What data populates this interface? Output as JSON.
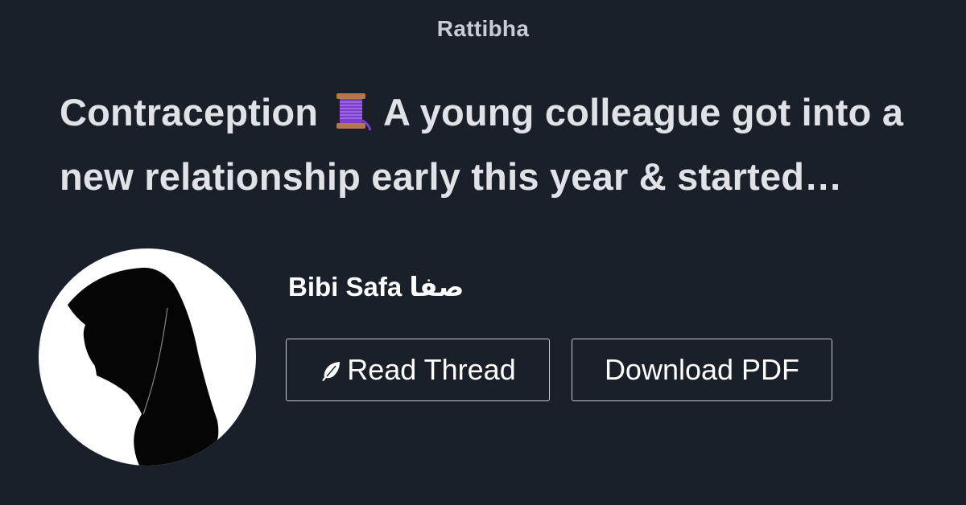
{
  "brand": "Rattibha",
  "thread": {
    "title_before_icon": "Contraception",
    "title_icon": "thread-spool-icon",
    "title_after_icon": "A young colleague got into a new relationship early this year & started…"
  },
  "author": {
    "name": "Bibi Safa صفا",
    "avatar": "hijab-silhouette-avatar"
  },
  "buttons": {
    "read_label": "Read Thread",
    "read_icon": "feather-icon",
    "pdf_label": "Download PDF"
  },
  "colors": {
    "background": "#1a202a",
    "text": "#dfe2e7",
    "spool": "#8b4fd6"
  }
}
